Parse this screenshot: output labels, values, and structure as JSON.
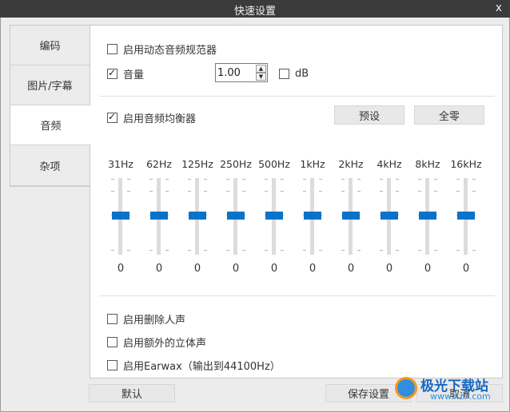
{
  "window": {
    "title": "快速设置",
    "close_label": "x"
  },
  "tabs": [
    {
      "label": "编码"
    },
    {
      "label": "图片/字幕"
    },
    {
      "label": "音频"
    },
    {
      "label": "杂项"
    }
  ],
  "audio": {
    "dynamic_normalizer": {
      "label": "启用动态音频规范器",
      "checked": false
    },
    "volume": {
      "label": "音量",
      "checked": true,
      "value": "1.00",
      "db_label": "dB",
      "db_checked": false
    },
    "equalizer": {
      "label": "启用音频均衡器",
      "checked": true,
      "preset_label": "预设",
      "zero_label": "全零",
      "bands": [
        {
          "freq": "31Hz",
          "value": "0"
        },
        {
          "freq": "62Hz",
          "value": "0"
        },
        {
          "freq": "125Hz",
          "value": "0"
        },
        {
          "freq": "250Hz",
          "value": "0"
        },
        {
          "freq": "500Hz",
          "value": "0"
        },
        {
          "freq": "1kHz",
          "value": "0"
        },
        {
          "freq": "2kHz",
          "value": "0"
        },
        {
          "freq": "4kHz",
          "value": "0"
        },
        {
          "freq": "8kHz",
          "value": "0"
        },
        {
          "freq": "16kHz",
          "value": "0"
        }
      ]
    },
    "remove_vocals": {
      "label": "启用删除人声",
      "checked": false
    },
    "extra_stereo": {
      "label": "启用额外的立体声",
      "checked": false
    },
    "earwax": {
      "label": "启用Earwax（输出到44100Hz）",
      "checked": false
    }
  },
  "footer": {
    "default_label": "默认",
    "save_label": "保存设置",
    "cancel_label": "取消"
  },
  "watermark": {
    "brand": "极光下载站",
    "url": "www.xz7.com"
  }
}
